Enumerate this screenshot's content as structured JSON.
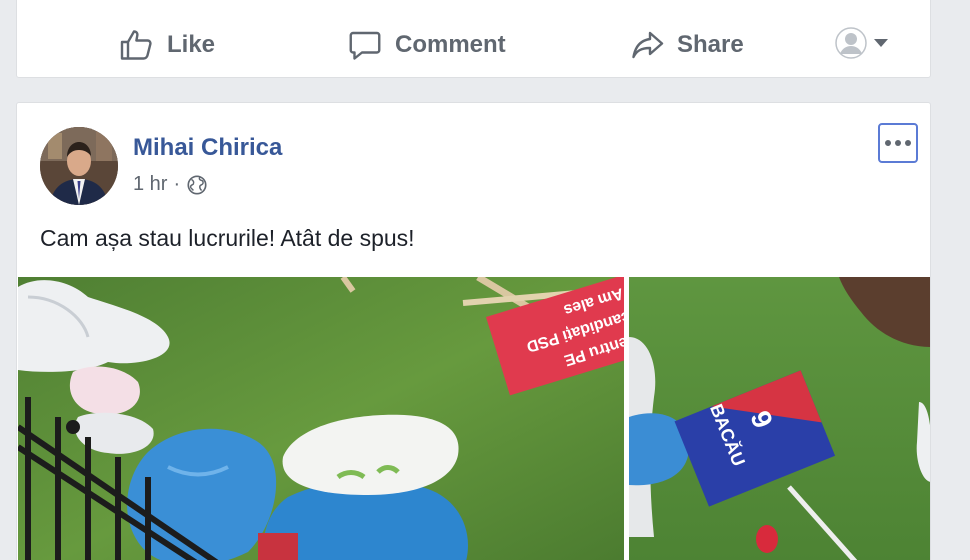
{
  "actions": {
    "like": "Like",
    "comment": "Comment",
    "share": "Share"
  },
  "post": {
    "author": "Mihai Chirica",
    "time": "1 hr",
    "separator": "·",
    "text": "Cam așa stau lucrurile! Atât de spus!"
  },
  "photos": {
    "sign1_lines": [
      "pentru PE",
      "candidați PSD",
      "Am ales"
    ],
    "sign2_number": "9",
    "sign2_city": "BACĂU"
  },
  "colors": {
    "link_blue": "#385898",
    "muted_gray": "#606770",
    "grass_green": "#5c8a3a",
    "sign_red": "#e03a4e",
    "sign_blue": "#2a3fa8"
  },
  "icons": {
    "like": "thumbs-up-icon",
    "comment": "speech-bubble-icon",
    "share": "share-arrow-icon",
    "audience": "globe-icon",
    "more": "ellipsis-icon"
  }
}
